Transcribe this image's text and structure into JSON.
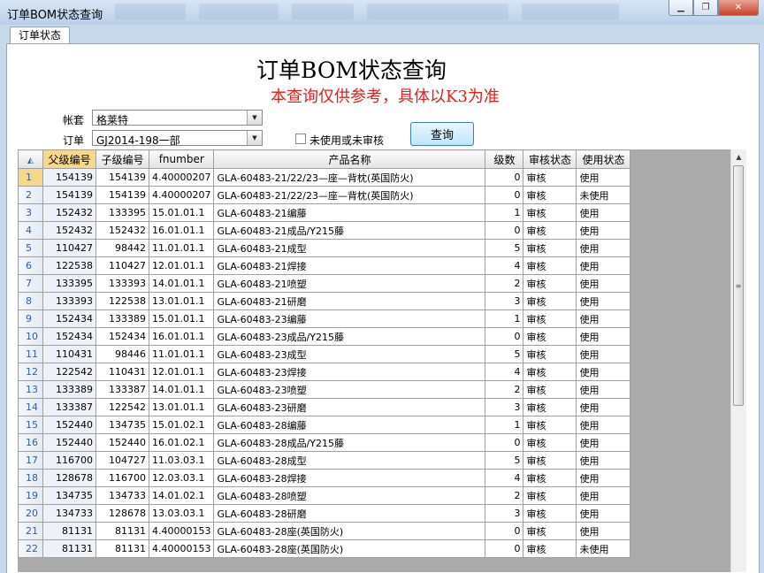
{
  "window": {
    "title": "订单BOM状态查询"
  },
  "tabs": [
    {
      "label": "订单状态"
    }
  ],
  "heading": "订单BOM状态查询",
  "notice": "本查询仅供参考，具体以K3为准",
  "form": {
    "account_label": "帐套",
    "account_value": "格莱特",
    "order_label": "订单",
    "order_value": "GJ2014-198一部",
    "checkbox_label": "未使用或未审核",
    "checkbox_checked": false,
    "query_button": "查询"
  },
  "table": {
    "columns": [
      "父级编号",
      "子级编号",
      "fnumber",
      "产品名称",
      "级数",
      "审核状态",
      "使用状态"
    ],
    "rows": [
      [
        "1",
        "154139",
        "154139",
        "4.40000207",
        "GLA-60483-21/22/23—座—背枕(英国防火)",
        "0",
        "审核",
        "使用"
      ],
      [
        "2",
        "154139",
        "154139",
        "4.40000207",
        "GLA-60483-21/22/23—座—背枕(英国防火)",
        "0",
        "审核",
        "未使用"
      ],
      [
        "3",
        "152432",
        "133395",
        "15.01.01.1",
        "GLA-60483-21编藤",
        "1",
        "审核",
        "使用"
      ],
      [
        "4",
        "152432",
        "152432",
        "16.01.01.1",
        "GLA-60483-21成品/Y215藤",
        "0",
        "审核",
        "使用"
      ],
      [
        "5",
        "110427",
        "98442",
        "11.01.01.1",
        "GLA-60483-21成型",
        "5",
        "审核",
        "使用"
      ],
      [
        "6",
        "122538",
        "110427",
        "12.01.01.1",
        "GLA-60483-21焊接",
        "4",
        "审核",
        "使用"
      ],
      [
        "7",
        "133395",
        "133393",
        "14.01.01.1",
        "GLA-60483-21喷塑",
        "2",
        "审核",
        "使用"
      ],
      [
        "8",
        "133393",
        "122538",
        "13.01.01.1",
        "GLA-60483-21研磨",
        "3",
        "审核",
        "使用"
      ],
      [
        "9",
        "152434",
        "133389",
        "15.01.01.1",
        "GLA-60483-23编藤",
        "1",
        "审核",
        "使用"
      ],
      [
        "10",
        "152434",
        "152434",
        "16.01.01.1",
        "GLA-60483-23成品/Y215藤",
        "0",
        "审核",
        "使用"
      ],
      [
        "11",
        "110431",
        "98446",
        "11.01.01.1",
        "GLA-60483-23成型",
        "5",
        "审核",
        "使用"
      ],
      [
        "12",
        "122542",
        "110431",
        "12.01.01.1",
        "GLA-60483-23焊接",
        "4",
        "审核",
        "使用"
      ],
      [
        "13",
        "133389",
        "133387",
        "14.01.01.1",
        "GLA-60483-23喷塑",
        "2",
        "审核",
        "使用"
      ],
      [
        "14",
        "133387",
        "122542",
        "13.01.01.1",
        "GLA-60483-23研磨",
        "3",
        "审核",
        "使用"
      ],
      [
        "15",
        "152440",
        "134735",
        "15.01.02.1",
        "GLA-60483-28编藤",
        "1",
        "审核",
        "使用"
      ],
      [
        "16",
        "152440",
        "152440",
        "16.01.02.1",
        "GLA-60483-28成品/Y215藤",
        "0",
        "审核",
        "使用"
      ],
      [
        "17",
        "116700",
        "104727",
        "11.03.03.1",
        "GLA-60483-28成型",
        "5",
        "审核",
        "使用"
      ],
      [
        "18",
        "128678",
        "116700",
        "12.03.03.1",
        "GLA-60483-28焊接",
        "4",
        "审核",
        "使用"
      ],
      [
        "19",
        "134735",
        "134733",
        "14.01.02.1",
        "GLA-60483-28喷塑",
        "2",
        "审核",
        "使用"
      ],
      [
        "20",
        "134733",
        "128678",
        "13.03.03.1",
        "GLA-60483-28研磨",
        "3",
        "审核",
        "使用"
      ],
      [
        "21",
        "81131",
        "81131",
        "4.40000153",
        "GLA-60483-28座(英国防火)",
        "0",
        "审核",
        "使用"
      ],
      [
        "22",
        "81131",
        "81131",
        "4.40000153",
        "GLA-60483-28座(英国防火)",
        "0",
        "审核",
        "未使用"
      ]
    ]
  },
  "icons": {
    "minimize": "minimize-icon",
    "restore": "restore-icon",
    "close": "close-icon",
    "combo_arrow": "chevron-down-icon"
  }
}
